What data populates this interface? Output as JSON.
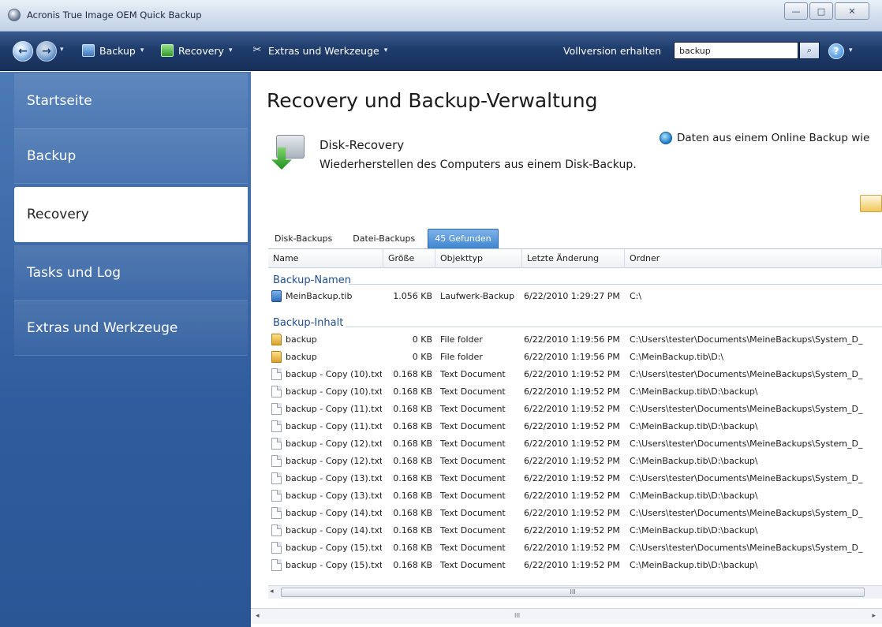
{
  "window": {
    "title": "Acronis True Image OEM Quick Backup",
    "minimize_glyph": "—",
    "maximize_glyph": "□",
    "close_glyph": "✕"
  },
  "toolbar": {
    "back_glyph": "←",
    "forward_glyph": "→",
    "history_caret": "▾",
    "menus": [
      {
        "label": "Backup",
        "icon": "backup-icon"
      },
      {
        "label": "Recovery",
        "icon": "recovery-icon"
      },
      {
        "label": "Extras und Werkzeuge",
        "icon": "tools-icon"
      }
    ],
    "caret": "▾",
    "extras_glyph": "✂",
    "vollversion_label": "Vollversion erhalten",
    "search_value": "backup",
    "search_glyph": "⌕",
    "help_glyph": "?"
  },
  "sidebar": {
    "items": [
      {
        "label": "Startseite",
        "active": false
      },
      {
        "label": "Backup",
        "active": false
      },
      {
        "label": "Recovery",
        "active": true
      },
      {
        "label": "Tasks und Log",
        "active": false
      },
      {
        "label": "Extras und Werkzeuge",
        "active": false
      }
    ]
  },
  "main": {
    "title": "Recovery und Backup-Verwaltung",
    "disk_recovery": {
      "title": "Disk-Recovery",
      "description": "Wiederherstellen des Computers aus einem Disk-Backup."
    },
    "online_link": "Daten aus einem Online Backup wie",
    "tabs": [
      {
        "label": "Disk-Backups",
        "active": false
      },
      {
        "label": "Datei-Backups",
        "active": false
      },
      {
        "label": "45 Gefunden",
        "active": true
      }
    ],
    "columns": [
      "Name",
      "Größe",
      "Objekttyp",
      "Letzte Änderung",
      "Ordner"
    ],
    "groups": {
      "names_title": "Backup-Namen",
      "content_title": "Backup-Inhalt"
    },
    "backup_names": [
      {
        "icon": "tib",
        "name": "MeinBackup.tib",
        "size": "1.056 KB",
        "type": "Laufwerk-Backup",
        "modified": "6/22/2010 1:29:27 PM",
        "folder": "C:\\"
      }
    ],
    "backup_content": [
      {
        "icon": "folder",
        "name": "backup",
        "size": "0 KB",
        "type": "File folder",
        "modified": "6/22/2010 1:19:56 PM",
        "folder": "C:\\Users\\tester\\Documents\\MeineBackups\\System_D_"
      },
      {
        "icon": "folder",
        "name": "backup",
        "size": "0 KB",
        "type": "File folder",
        "modified": "6/22/2010 1:19:56 PM",
        "folder": "C:\\MeinBackup.tib\\D:\\"
      },
      {
        "icon": "txt",
        "name": "backup - Copy (10).txt",
        "size": "0.168 KB",
        "type": "Text Document",
        "modified": "6/22/2010 1:19:52 PM",
        "folder": "C:\\Users\\tester\\Documents\\MeineBackups\\System_D_"
      },
      {
        "icon": "txt",
        "name": "backup - Copy (10).txt",
        "size": "0.168 KB",
        "type": "Text Document",
        "modified": "6/22/2010 1:19:52 PM",
        "folder": "C:\\MeinBackup.tib\\D:\\backup\\"
      },
      {
        "icon": "txt",
        "name": "backup - Copy (11).txt",
        "size": "0.168 KB",
        "type": "Text Document",
        "modified": "6/22/2010 1:19:52 PM",
        "folder": "C:\\Users\\tester\\Documents\\MeineBackups\\System_D_"
      },
      {
        "icon": "txt",
        "name": "backup - Copy (11).txt",
        "size": "0.168 KB",
        "type": "Text Document",
        "modified": "6/22/2010 1:19:52 PM",
        "folder": "C:\\MeinBackup.tib\\D:\\backup\\"
      },
      {
        "icon": "txt",
        "name": "backup - Copy (12).txt",
        "size": "0.168 KB",
        "type": "Text Document",
        "modified": "6/22/2010 1:19:52 PM",
        "folder": "C:\\Users\\tester\\Documents\\MeineBackups\\System_D_"
      },
      {
        "icon": "txt",
        "name": "backup - Copy (12).txt",
        "size": "0.168 KB",
        "type": "Text Document",
        "modified": "6/22/2010 1:19:52 PM",
        "folder": "C:\\MeinBackup.tib\\D:\\backup\\"
      },
      {
        "icon": "txt",
        "name": "backup - Copy (13).txt",
        "size": "0.168 KB",
        "type": "Text Document",
        "modified": "6/22/2010 1:19:52 PM",
        "folder": "C:\\Users\\tester\\Documents\\MeineBackups\\System_D_"
      },
      {
        "icon": "txt",
        "name": "backup - Copy (13).txt",
        "size": "0.168 KB",
        "type": "Text Document",
        "modified": "6/22/2010 1:19:52 PM",
        "folder": "C:\\MeinBackup.tib\\D:\\backup\\"
      },
      {
        "icon": "txt",
        "name": "backup - Copy (14).txt",
        "size": "0.168 KB",
        "type": "Text Document",
        "modified": "6/22/2010 1:19:52 PM",
        "folder": "C:\\Users\\tester\\Documents\\MeineBackups\\System_D_"
      },
      {
        "icon": "txt",
        "name": "backup - Copy (14).txt",
        "size": "0.168 KB",
        "type": "Text Document",
        "modified": "6/22/2010 1:19:52 PM",
        "folder": "C:\\MeinBackup.tib\\D:\\backup\\"
      },
      {
        "icon": "txt",
        "name": "backup - Copy (15).txt",
        "size": "0.168 KB",
        "type": "Text Document",
        "modified": "6/22/2010 1:19:52 PM",
        "folder": "C:\\Users\\tester\\Documents\\MeineBackups\\System_D_"
      },
      {
        "icon": "txt",
        "name": "backup - Copy (15).txt",
        "size": "0.168 KB",
        "type": "Text Document",
        "modified": "6/22/2010 1:19:52 PM",
        "folder": "C:\\MeinBackup.tib\\D:\\backup\\"
      }
    ],
    "scroll": {
      "left_glyph": "◂",
      "right_glyph": "▸",
      "grip_glyph": "III"
    }
  }
}
